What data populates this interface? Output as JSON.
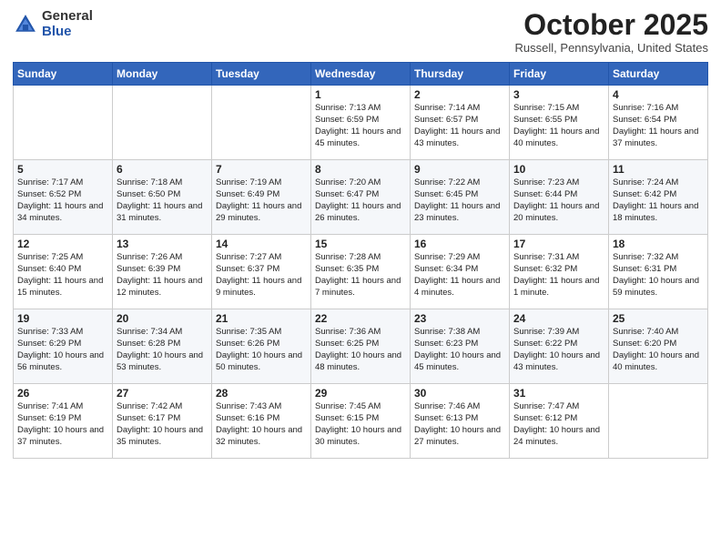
{
  "header": {
    "logo_general": "General",
    "logo_blue": "Blue",
    "month_title": "October 2025",
    "location": "Russell, Pennsylvania, United States"
  },
  "days_of_week": [
    "Sunday",
    "Monday",
    "Tuesday",
    "Wednesday",
    "Thursday",
    "Friday",
    "Saturday"
  ],
  "weeks": [
    [
      {
        "day": "",
        "info": ""
      },
      {
        "day": "",
        "info": ""
      },
      {
        "day": "",
        "info": ""
      },
      {
        "day": "1",
        "info": "Sunrise: 7:13 AM\nSunset: 6:59 PM\nDaylight: 11 hours and 45 minutes."
      },
      {
        "day": "2",
        "info": "Sunrise: 7:14 AM\nSunset: 6:57 PM\nDaylight: 11 hours and 43 minutes."
      },
      {
        "day": "3",
        "info": "Sunrise: 7:15 AM\nSunset: 6:55 PM\nDaylight: 11 hours and 40 minutes."
      },
      {
        "day": "4",
        "info": "Sunrise: 7:16 AM\nSunset: 6:54 PM\nDaylight: 11 hours and 37 minutes."
      }
    ],
    [
      {
        "day": "5",
        "info": "Sunrise: 7:17 AM\nSunset: 6:52 PM\nDaylight: 11 hours and 34 minutes."
      },
      {
        "day": "6",
        "info": "Sunrise: 7:18 AM\nSunset: 6:50 PM\nDaylight: 11 hours and 31 minutes."
      },
      {
        "day": "7",
        "info": "Sunrise: 7:19 AM\nSunset: 6:49 PM\nDaylight: 11 hours and 29 minutes."
      },
      {
        "day": "8",
        "info": "Sunrise: 7:20 AM\nSunset: 6:47 PM\nDaylight: 11 hours and 26 minutes."
      },
      {
        "day": "9",
        "info": "Sunrise: 7:22 AM\nSunset: 6:45 PM\nDaylight: 11 hours and 23 minutes."
      },
      {
        "day": "10",
        "info": "Sunrise: 7:23 AM\nSunset: 6:44 PM\nDaylight: 11 hours and 20 minutes."
      },
      {
        "day": "11",
        "info": "Sunrise: 7:24 AM\nSunset: 6:42 PM\nDaylight: 11 hours and 18 minutes."
      }
    ],
    [
      {
        "day": "12",
        "info": "Sunrise: 7:25 AM\nSunset: 6:40 PM\nDaylight: 11 hours and 15 minutes."
      },
      {
        "day": "13",
        "info": "Sunrise: 7:26 AM\nSunset: 6:39 PM\nDaylight: 11 hours and 12 minutes."
      },
      {
        "day": "14",
        "info": "Sunrise: 7:27 AM\nSunset: 6:37 PM\nDaylight: 11 hours and 9 minutes."
      },
      {
        "day": "15",
        "info": "Sunrise: 7:28 AM\nSunset: 6:35 PM\nDaylight: 11 hours and 7 minutes."
      },
      {
        "day": "16",
        "info": "Sunrise: 7:29 AM\nSunset: 6:34 PM\nDaylight: 11 hours and 4 minutes."
      },
      {
        "day": "17",
        "info": "Sunrise: 7:31 AM\nSunset: 6:32 PM\nDaylight: 11 hours and 1 minute."
      },
      {
        "day": "18",
        "info": "Sunrise: 7:32 AM\nSunset: 6:31 PM\nDaylight: 10 hours and 59 minutes."
      }
    ],
    [
      {
        "day": "19",
        "info": "Sunrise: 7:33 AM\nSunset: 6:29 PM\nDaylight: 10 hours and 56 minutes."
      },
      {
        "day": "20",
        "info": "Sunrise: 7:34 AM\nSunset: 6:28 PM\nDaylight: 10 hours and 53 minutes."
      },
      {
        "day": "21",
        "info": "Sunrise: 7:35 AM\nSunset: 6:26 PM\nDaylight: 10 hours and 50 minutes."
      },
      {
        "day": "22",
        "info": "Sunrise: 7:36 AM\nSunset: 6:25 PM\nDaylight: 10 hours and 48 minutes."
      },
      {
        "day": "23",
        "info": "Sunrise: 7:38 AM\nSunset: 6:23 PM\nDaylight: 10 hours and 45 minutes."
      },
      {
        "day": "24",
        "info": "Sunrise: 7:39 AM\nSunset: 6:22 PM\nDaylight: 10 hours and 43 minutes."
      },
      {
        "day": "25",
        "info": "Sunrise: 7:40 AM\nSunset: 6:20 PM\nDaylight: 10 hours and 40 minutes."
      }
    ],
    [
      {
        "day": "26",
        "info": "Sunrise: 7:41 AM\nSunset: 6:19 PM\nDaylight: 10 hours and 37 minutes."
      },
      {
        "day": "27",
        "info": "Sunrise: 7:42 AM\nSunset: 6:17 PM\nDaylight: 10 hours and 35 minutes."
      },
      {
        "day": "28",
        "info": "Sunrise: 7:43 AM\nSunset: 6:16 PM\nDaylight: 10 hours and 32 minutes."
      },
      {
        "day": "29",
        "info": "Sunrise: 7:45 AM\nSunset: 6:15 PM\nDaylight: 10 hours and 30 minutes."
      },
      {
        "day": "30",
        "info": "Sunrise: 7:46 AM\nSunset: 6:13 PM\nDaylight: 10 hours and 27 minutes."
      },
      {
        "day": "31",
        "info": "Sunrise: 7:47 AM\nSunset: 6:12 PM\nDaylight: 10 hours and 24 minutes."
      },
      {
        "day": "",
        "info": ""
      }
    ]
  ]
}
